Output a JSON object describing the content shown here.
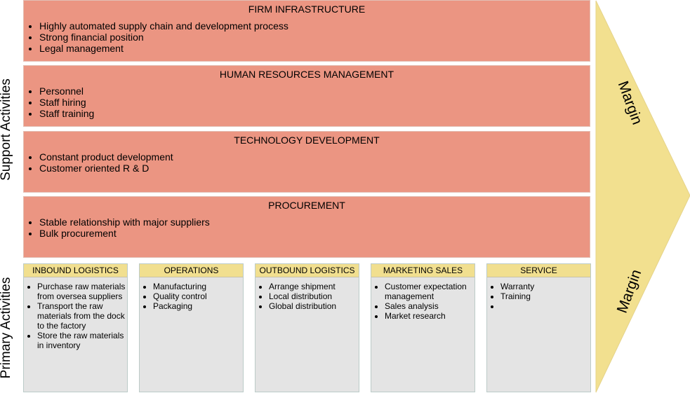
{
  "labels": {
    "support": "Support Activities",
    "primary": "Primary Activities"
  },
  "support": [
    {
      "title": "FIRM INFRASTRUCTURE",
      "items": [
        "Highly automated supply chain and development process",
        "Strong financial position",
        "Legal management"
      ]
    },
    {
      "title": "HUMAN RESOURCES MANAGEMENT",
      "items": [
        "Personnel",
        "Staff hiring",
        "Staff training"
      ]
    },
    {
      "title": "TECHNOLOGY DEVELOPMENT",
      "items": [
        "Constant product development",
        "Customer oriented R & D"
      ]
    },
    {
      "title": "PROCUREMENT",
      "items": [
        "Stable relationship with major suppliers",
        "Bulk procurement"
      ]
    }
  ],
  "primary": [
    {
      "title": "INBOUND LOGISTICS",
      "items": [
        "Purchase raw materials from oversea suppliers",
        "Transport the raw materials from the dock to the factory",
        "Store the raw materials in inventory"
      ]
    },
    {
      "title": "OPERATIONS",
      "items": [
        "Manufacturing",
        "Quality control",
        "Packaging"
      ]
    },
    {
      "title": "OUTBOUND LOGISTICS",
      "items": [
        "Arrange shipment",
        "Local distribution",
        "Global distribution"
      ]
    },
    {
      "title": "MARKETING SALES",
      "items": [
        "Customer expectation management",
        "Sales analysis",
        "Market research"
      ]
    },
    {
      "title": "SERVICE",
      "items": [
        "Warranty",
        "Training",
        ""
      ]
    }
  ],
  "margin": {
    "top": "Margin",
    "bottom": "Margin"
  },
  "colors": {
    "support_fill": "#eb9582",
    "primary_header": "#f1df8f",
    "primary_body": "#e4e4e4",
    "margin_fill": "#f2e08f"
  }
}
